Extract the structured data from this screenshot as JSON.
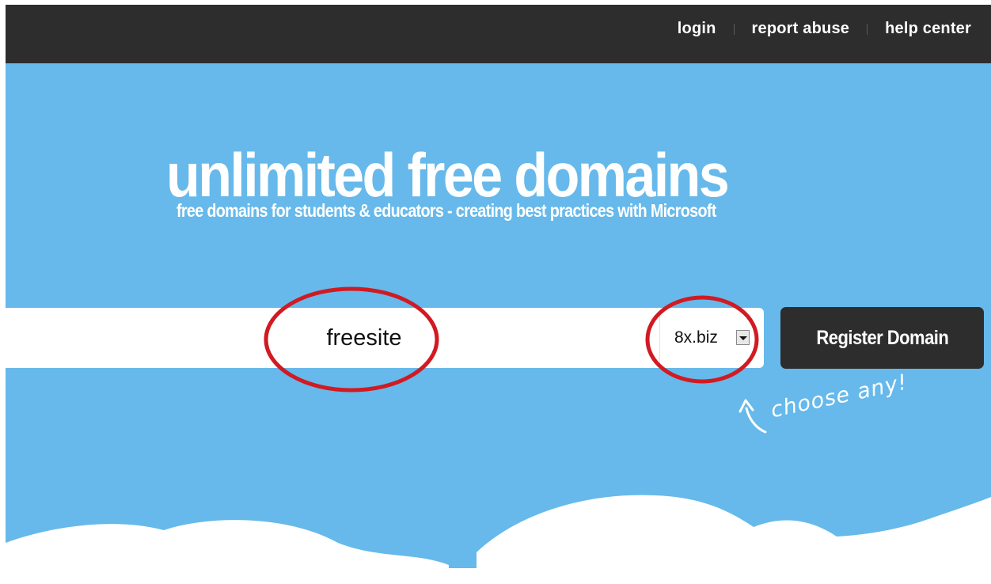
{
  "nav": {
    "items": [
      "login",
      "report abuse",
      "help center"
    ]
  },
  "hero": {
    "title": "unlimited free domains",
    "subtitle": "free domains for students & educators - creating best practices with Microsoft"
  },
  "search": {
    "value": "freesite"
  },
  "tld": {
    "selected": "8x.biz"
  },
  "register_label": "Register Domain",
  "hint": "choose any!",
  "colors": {
    "sky": "#66b9ea",
    "topbar": "#2d2d2d",
    "annotation": "#d11a22"
  }
}
